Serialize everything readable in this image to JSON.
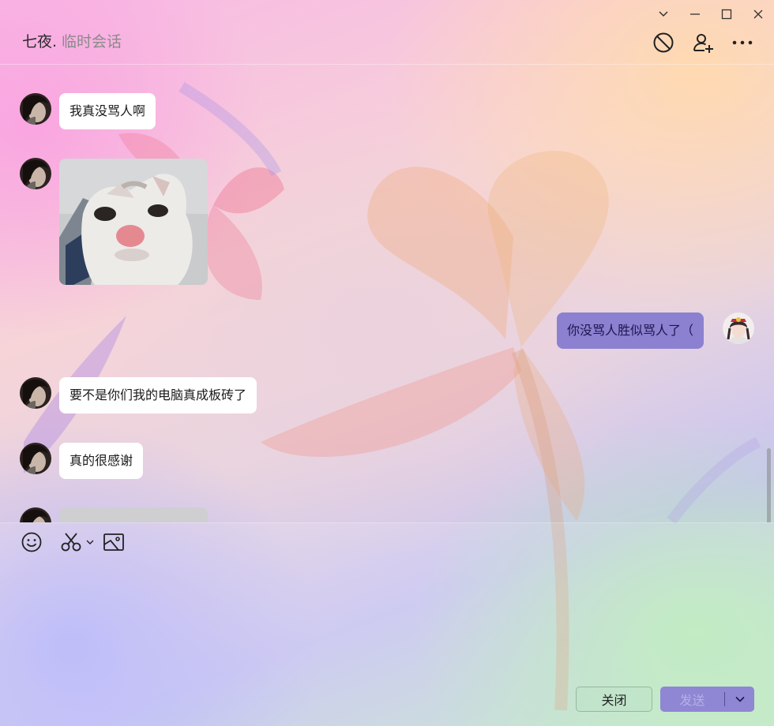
{
  "header": {
    "contact_name": "七夜.",
    "session_type": "临时会话",
    "icons": [
      "block-icon",
      "add-friend-icon",
      "more-icon"
    ]
  },
  "window_controls": [
    "collapse-icon",
    "minimize-icon",
    "maximize-icon",
    "close-icon"
  ],
  "messages": [
    {
      "sender": "other",
      "type": "text",
      "text": "我真没骂人啊"
    },
    {
      "sender": "other",
      "type": "image",
      "content": "cat-meme"
    },
    {
      "sender": "self",
      "type": "text",
      "text": "你没骂人胜似骂人了（"
    },
    {
      "sender": "other",
      "type": "text",
      "text": "要不是你们我的电脑真成板砖了"
    },
    {
      "sender": "other",
      "type": "text",
      "text": "真的很感谢"
    },
    {
      "sender": "other",
      "type": "image",
      "content": "partially-visible"
    }
  ],
  "toolbar": {
    "icons": [
      "emoji-icon",
      "scissors-icon",
      "scissors-dropdown-icon",
      "image-icon"
    ]
  },
  "footer": {
    "close_label": "关闭",
    "send_label": "发送"
  },
  "colors": {
    "self_bubble": "#8c80d0",
    "other_bubble": "#ffffff",
    "send_button": "#8f86d4",
    "send_text_disabled": "#b7b0e6"
  }
}
